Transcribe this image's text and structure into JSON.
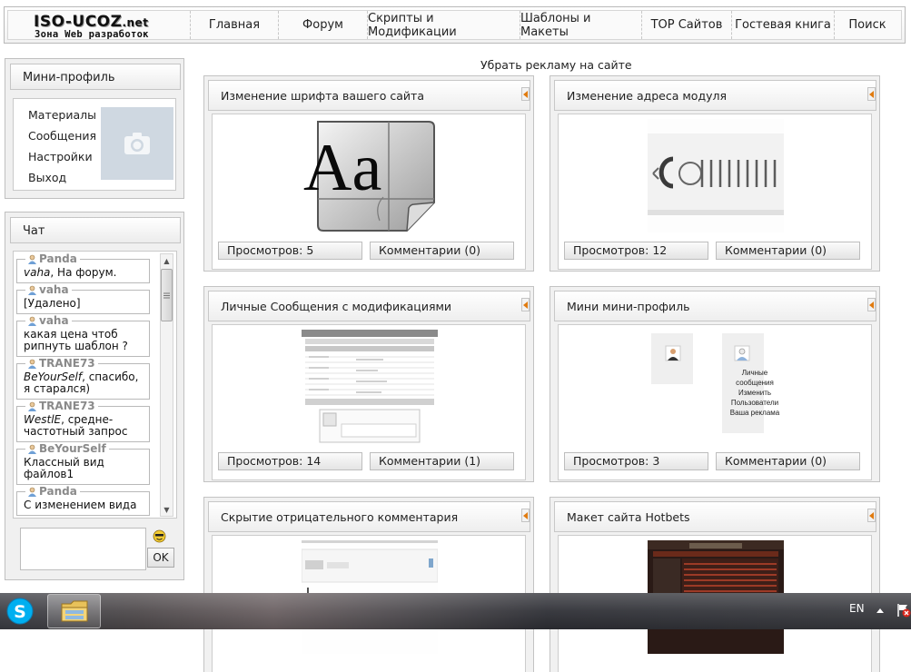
{
  "logo": {
    "main": "ISO-UCOZ",
    "tld": ".net",
    "subtitle": "Зона Web разработок"
  },
  "nav": [
    "Главная",
    "Форум",
    "Скрипты и Модификации",
    "Шаблоны и Макеты",
    "TOP Сайтов",
    "Гостевая книга",
    "Поиск"
  ],
  "profile": {
    "title": "Мини-профиль",
    "links": [
      "Материалы",
      "Сообщения",
      "Настройки",
      "Выход"
    ]
  },
  "chat": {
    "title": "Чат",
    "messages": [
      {
        "name": "Panda",
        "mention": "vaha",
        "text": ", На форум."
      },
      {
        "name": "vaha",
        "mention": "",
        "text": "[Удалено]"
      },
      {
        "name": "vaha",
        "mention": "",
        "text": "какая цена чтоб рипнуть шаблон ?"
      },
      {
        "name": "TRANE73",
        "mention": "BeYourSelf",
        "text": ", спасибо, я старался)"
      },
      {
        "name": "TRANE73",
        "mention": "WestlE",
        "text": ", средне-частотный запрос"
      },
      {
        "name": "BeYourSelf",
        "mention": "",
        "text": "Классный вид файлов1"
      },
      {
        "name": "Panda",
        "mention": "",
        "text": "С изменением вида"
      }
    ],
    "send_label": "OK"
  },
  "ad_text": "Убрать рекламу на сайте",
  "cards": [
    {
      "title": "Изменение шрифта вашего сайта",
      "views": "Просмотров: 5",
      "comments": "Комментарии (0)"
    },
    {
      "title": "Изменение адреса модуля",
      "views": "Просмотров: 12",
      "comments": "Комментарии (0)"
    },
    {
      "title": "Личные Сообщения с модификациями",
      "views": "Просмотров: 14",
      "comments": "Комментарии (1)"
    },
    {
      "title": "Мини мини-профиль",
      "views": "Просмотров: 3",
      "comments": "Комментарии (0)",
      "menu": [
        "Личные сообщения",
        "Изменить",
        "Пользователи",
        "Ваша реклама"
      ]
    },
    {
      "title": "Скрытие отрицательного комментария",
      "views": "",
      "comments": ""
    },
    {
      "title": "Макет сайта Hotbets",
      "views": "",
      "comments": ""
    }
  ],
  "taskbar": {
    "lang": "EN"
  },
  "icons": {
    "skype": "skype-icon",
    "explorer": "folder-explorer-icon",
    "camera": "camera-icon",
    "user": "user-icon",
    "emoji": "emoticon-icon",
    "collapse": "collapse-arrow-icon"
  },
  "colors": {
    "accent_arrow": "#e07b10",
    "avatar_bg": "#cfd8e1"
  }
}
